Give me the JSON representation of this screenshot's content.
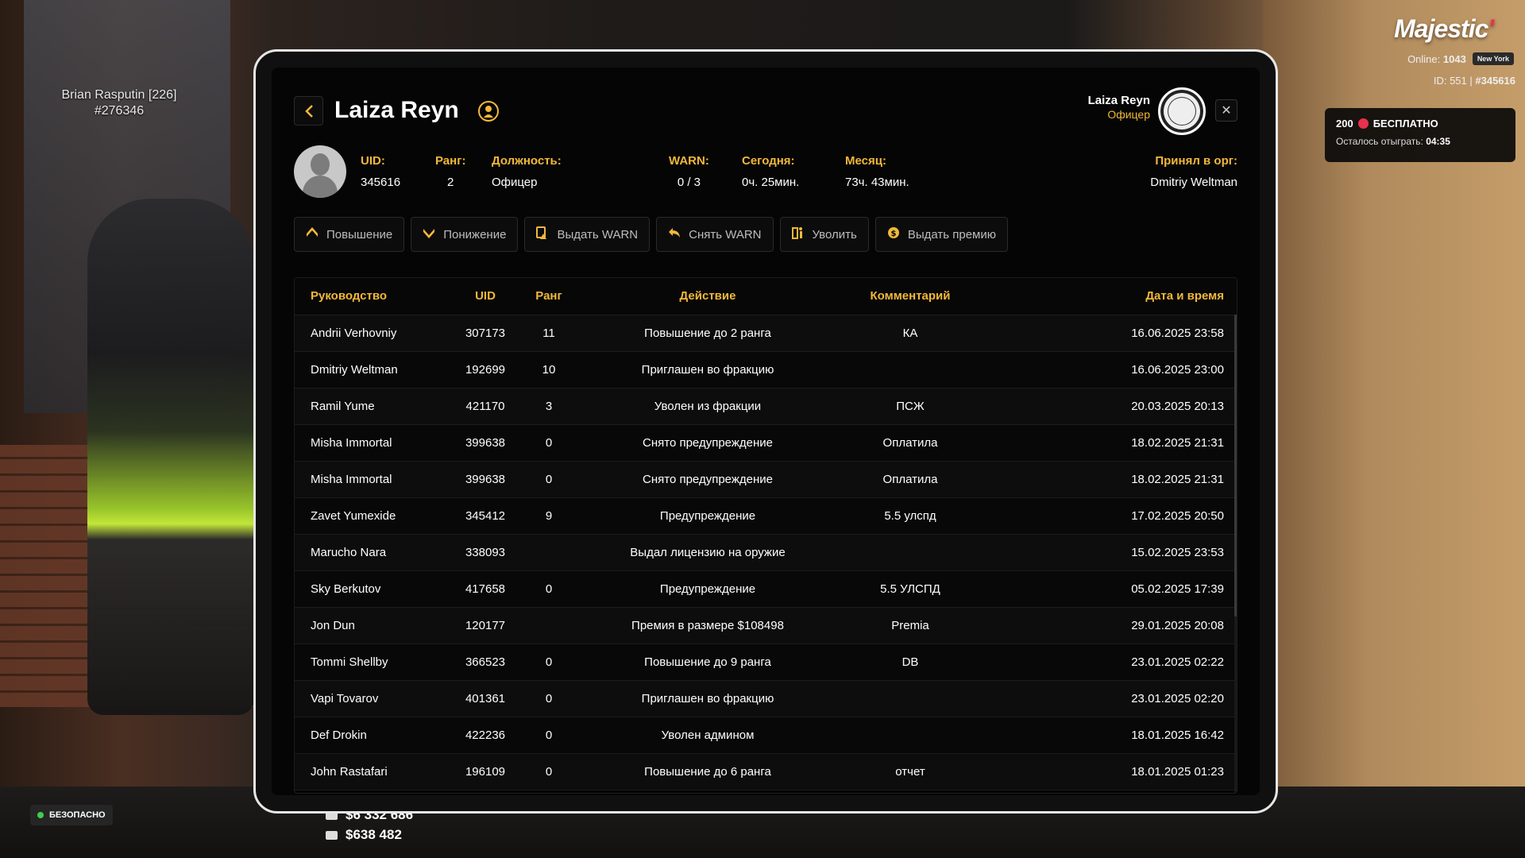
{
  "hud": {
    "player_name": "Brian Rasputin [226]",
    "player_id": "#276346",
    "logo": "Majestic",
    "online_label": "Online:",
    "online_count": "1043",
    "city": "New York",
    "id_prefix": "ID: 551 |",
    "id_value": "#345616",
    "promo_amount": "200",
    "promo_label": "БЕСПЛАТНО",
    "promo_remaining_label": "Осталось отыграть:",
    "promo_remaining_time": "04:35",
    "safe_label": "БЕЗОПАСНО",
    "cash": "$6 332 686",
    "bank": "$638 482"
  },
  "header": {
    "title": "Laiza Reyn",
    "user_name": "Laiza Reyn",
    "user_role": "Офицер"
  },
  "info": {
    "uid_label": "UID:",
    "uid": "345616",
    "rank_label": "Ранг:",
    "rank": "2",
    "position_label": "Должность:",
    "position": "Офицер",
    "warn_label": "WARN:",
    "warn": "0 / 3",
    "today_label": "Сегодня:",
    "today": "0ч. 25мин.",
    "month_label": "Месяц:",
    "month": "73ч. 43мин.",
    "accepted_label": "Принял в орг:",
    "accepted_by": "Dmitriy Weltman"
  },
  "actions": {
    "promote": "Повышение",
    "demote": "Понижение",
    "give_warn": "Выдать WARN",
    "remove_warn": "Снять WARN",
    "fire": "Уволить",
    "bonus": "Выдать премию"
  },
  "table": {
    "headers": [
      "Руководство",
      "UID",
      "Ранг",
      "Действие",
      "Комментарий",
      "Дата и время"
    ],
    "rows": [
      [
        "Andrii Verhovniy",
        "307173",
        "11",
        "Повышение до 2 ранга",
        "КА",
        "16.06.2025 23:58"
      ],
      [
        "Dmitriy Weltman",
        "192699",
        "10",
        "Приглашен во фракцию",
        "",
        "16.06.2025 23:00"
      ],
      [
        "Ramil Yume",
        "421170",
        "3",
        "Уволен из фракции",
        "ПСЖ",
        "20.03.2025 20:13"
      ],
      [
        "Misha Immortal",
        "399638",
        "0",
        "Снято предупреждение",
        "Оплатила",
        "18.02.2025 21:31"
      ],
      [
        "Misha Immortal",
        "399638",
        "0",
        "Снято предупреждение",
        "Оплатила",
        "18.02.2025 21:31"
      ],
      [
        "Zavet Yumexide",
        "345412",
        "9",
        "Предупреждение",
        "5.5 улспд",
        "17.02.2025 20:50"
      ],
      [
        "Marucho Nara",
        "338093",
        "",
        "Выдал лицензию на оружие",
        "",
        "15.02.2025 23:53"
      ],
      [
        "Sky Berkutov",
        "417658",
        "0",
        "Предупреждение",
        "5.5 УЛСПД",
        "05.02.2025 17:39"
      ],
      [
        "Jon Dun",
        "120177",
        "",
        "Премия в размере $108498",
        "Premia",
        "29.01.2025 20:08"
      ],
      [
        "Tommi Shellby",
        "366523",
        "0",
        "Повышение до 9 ранга",
        "DB",
        "23.01.2025 02:22"
      ],
      [
        "Vapi Tovarov",
        "401361",
        "0",
        "Приглашен во фракцию",
        "",
        "23.01.2025 02:20"
      ],
      [
        "Def Drokin",
        "422236",
        "0",
        "Уволен админом",
        "",
        "18.01.2025 16:42"
      ],
      [
        "John Rastafari",
        "196109",
        "0",
        "Повышение до 6 ранга",
        "отчет",
        "18.01.2025 01:23"
      ]
    ]
  },
  "colors": {
    "accent": "#f1b83a",
    "background": "#050505"
  }
}
